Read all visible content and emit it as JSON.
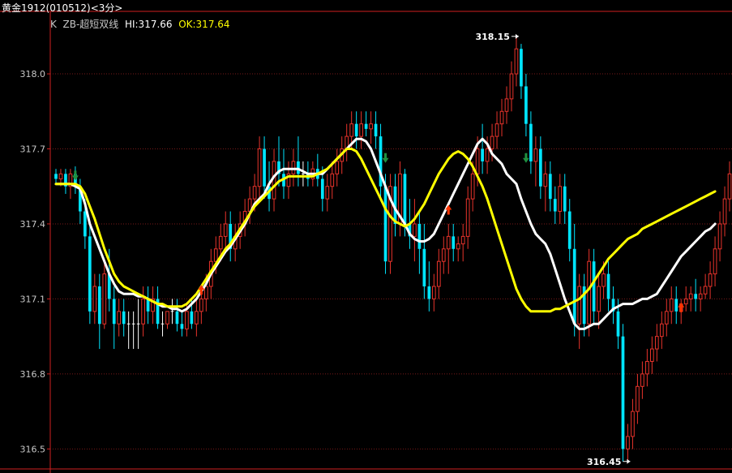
{
  "header": {
    "title": "黄金1912(010512)<3分>",
    "legend_prefix": "K",
    "indicator": "ZB-超短双线",
    "hi_label": "HI:317.66",
    "ok_label": "OK:317.64"
  },
  "colors": {
    "background": "#000000",
    "axis": "#d02020",
    "grid": "#7a1a1a",
    "up": "#e8332b",
    "down": "#00e5ff",
    "hi_line": "#ffffff",
    "ok_line": "#ffff00",
    "tick_text": "#c8c8c8",
    "marker_buy": "#ff3300",
    "marker_sell": "#1f8f3f"
  },
  "chart_data": {
    "type": "candlestick",
    "title": "",
    "xlabel": "",
    "ylabel": "",
    "ylim": [
      316.42,
      318.25
    ],
    "y_ticks": [
      "318.0",
      "317.7",
      "317.4",
      "317.1",
      "316.8",
      "316.5"
    ],
    "y_tick_values": [
      318.0,
      317.7,
      317.4,
      317.1,
      316.8,
      316.5
    ],
    "grid": "horizontal dotted",
    "annotations": {
      "high_label": "318.15",
      "high_value": 318.15,
      "high_index": 96,
      "low_label": "316.45",
      "low_value": 316.45,
      "low_index": 119
    },
    "ohlc": [
      [
        317.6,
        317.62,
        317.56,
        317.58
      ],
      [
        317.58,
        317.62,
        317.55,
        317.6
      ],
      [
        317.6,
        317.62,
        317.52,
        317.55
      ],
      [
        317.55,
        317.62,
        317.5,
        317.6
      ],
      [
        317.6,
        317.63,
        317.52,
        317.55
      ],
      [
        317.55,
        317.58,
        317.4,
        317.45
      ],
      [
        317.45,
        317.5,
        317.3,
        317.35
      ],
      [
        317.35,
        317.4,
        317.0,
        317.05
      ],
      [
        317.05,
        317.2,
        317.0,
        317.15
      ],
      [
        317.15,
        317.2,
        316.9,
        317.0
      ],
      [
        317.0,
        317.25,
        316.98,
        317.2
      ],
      [
        317.2,
        317.3,
        317.05,
        317.1
      ],
      [
        317.1,
        317.15,
        316.9,
        317.0
      ],
      [
        317.0,
        317.1,
        316.95,
        317.05
      ],
      [
        317.05,
        317.1,
        316.95,
        317.0
      ],
      [
        317.0,
        317.05,
        316.9,
        317.0
      ],
      [
        317.0,
        317.05,
        316.9,
        317.0
      ],
      [
        317.0,
        317.1,
        316.9,
        317.0
      ],
      [
        317.0,
        317.15,
        316.95,
        317.1
      ],
      [
        317.1,
        317.15,
        317.0,
        317.05
      ],
      [
        317.05,
        317.15,
        317.0,
        317.1
      ],
      [
        317.1,
        317.15,
        316.98,
        317.0
      ],
      [
        317.0,
        317.05,
        316.95,
        317.0
      ],
      [
        317.0,
        317.05,
        316.98,
        317.05
      ],
      [
        317.05,
        317.1,
        317.0,
        317.05
      ],
      [
        317.05,
        317.1,
        316.97,
        317.0
      ],
      [
        317.0,
        317.05,
        316.95,
        316.98
      ],
      [
        316.98,
        317.08,
        316.95,
        317.05
      ],
      [
        317.05,
        317.1,
        316.98,
        317.0
      ],
      [
        317.0,
        317.1,
        316.95,
        317.05
      ],
      [
        317.05,
        317.15,
        317.0,
        317.1
      ],
      [
        317.1,
        317.2,
        317.05,
        317.15
      ],
      [
        317.15,
        317.3,
        317.1,
        317.25
      ],
      [
        317.25,
        317.35,
        317.2,
        317.3
      ],
      [
        317.3,
        317.4,
        317.25,
        317.35
      ],
      [
        317.35,
        317.45,
        317.3,
        317.4
      ],
      [
        317.4,
        317.45,
        317.25,
        317.3
      ],
      [
        317.3,
        317.4,
        317.25,
        317.35
      ],
      [
        317.35,
        317.45,
        317.3,
        317.4
      ],
      [
        317.4,
        317.5,
        317.35,
        317.45
      ],
      [
        317.45,
        317.55,
        317.4,
        317.5
      ],
      [
        317.5,
        317.6,
        317.45,
        317.55
      ],
      [
        317.55,
        317.75,
        317.5,
        317.7
      ],
      [
        317.7,
        317.75,
        317.5,
        317.55
      ],
      [
        317.55,
        317.65,
        317.45,
        317.5
      ],
      [
        317.5,
        317.7,
        317.45,
        317.65
      ],
      [
        317.65,
        317.75,
        317.55,
        317.6
      ],
      [
        317.6,
        317.7,
        317.5,
        317.55
      ],
      [
        317.55,
        317.65,
        317.5,
        317.6
      ],
      [
        317.6,
        317.7,
        317.55,
        317.65
      ],
      [
        317.65,
        317.75,
        317.55,
        317.6
      ],
      [
        317.6,
        317.65,
        317.55,
        317.6
      ],
      [
        317.6,
        317.65,
        317.55,
        317.58
      ],
      [
        317.58,
        317.65,
        317.55,
        317.62
      ],
      [
        317.62,
        317.68,
        317.55,
        317.58
      ],
      [
        317.58,
        317.63,
        317.45,
        317.5
      ],
      [
        317.5,
        317.6,
        317.45,
        317.55
      ],
      [
        317.55,
        317.65,
        317.5,
        317.6
      ],
      [
        317.6,
        317.7,
        317.55,
        317.65
      ],
      [
        317.65,
        317.75,
        317.6,
        317.7
      ],
      [
        317.7,
        317.8,
        317.65,
        317.75
      ],
      [
        317.75,
        317.85,
        317.7,
        317.8
      ],
      [
        317.8,
        317.85,
        317.7,
        317.75
      ],
      [
        317.75,
        317.85,
        317.7,
        317.8
      ],
      [
        317.8,
        317.85,
        317.75,
        317.78
      ],
      [
        317.78,
        317.85,
        317.72,
        317.8
      ],
      [
        317.8,
        317.85,
        317.7,
        317.75
      ],
      [
        317.75,
        317.8,
        317.5,
        317.55
      ],
      [
        317.55,
        317.6,
        317.2,
        317.25
      ],
      [
        317.25,
        317.6,
        317.2,
        317.55
      ],
      [
        317.55,
        317.6,
        317.35,
        317.4
      ],
      [
        317.4,
        317.65,
        317.35,
        317.6
      ],
      [
        317.6,
        317.62,
        317.35,
        317.4
      ],
      [
        317.4,
        317.5,
        317.3,
        317.35
      ],
      [
        317.35,
        317.5,
        317.25,
        317.4
      ],
      [
        317.4,
        317.45,
        317.2,
        317.3
      ],
      [
        317.3,
        317.4,
        317.1,
        317.15
      ],
      [
        317.15,
        317.25,
        317.05,
        317.1
      ],
      [
        317.1,
        317.2,
        317.05,
        317.15
      ],
      [
        317.15,
        317.3,
        317.1,
        317.25
      ],
      [
        317.25,
        317.35,
        317.2,
        317.3
      ],
      [
        317.3,
        317.4,
        317.2,
        317.35
      ],
      [
        317.35,
        317.4,
        317.25,
        317.3
      ],
      [
        317.3,
        317.35,
        317.25,
        317.32
      ],
      [
        317.32,
        317.4,
        317.25,
        317.35
      ],
      [
        317.35,
        317.55,
        317.3,
        317.5
      ],
      [
        317.5,
        317.65,
        317.45,
        317.6
      ],
      [
        317.6,
        317.75,
        317.55,
        317.7
      ],
      [
        317.7,
        317.8,
        317.6,
        317.65
      ],
      [
        317.65,
        317.75,
        317.6,
        317.7
      ],
      [
        317.7,
        317.8,
        317.65,
        317.75
      ],
      [
        317.75,
        317.85,
        317.7,
        317.8
      ],
      [
        317.8,
        317.9,
        317.75,
        317.85
      ],
      [
        317.85,
        317.95,
        317.8,
        317.9
      ],
      [
        317.9,
        318.05,
        317.85,
        318.0
      ],
      [
        318.0,
        318.15,
        317.95,
        318.1
      ],
      [
        318.1,
        318.12,
        317.9,
        317.95
      ],
      [
        317.95,
        318.0,
        317.75,
        317.8
      ],
      [
        317.8,
        317.85,
        317.6,
        317.65
      ],
      [
        317.65,
        317.75,
        317.55,
        317.7
      ],
      [
        317.7,
        317.75,
        317.5,
        317.55
      ],
      [
        317.55,
        317.65,
        317.45,
        317.6
      ],
      [
        317.6,
        317.65,
        317.45,
        317.5
      ],
      [
        317.5,
        317.55,
        317.4,
        317.45
      ],
      [
        317.45,
        317.6,
        317.4,
        317.55
      ],
      [
        317.55,
        317.6,
        317.4,
        317.45
      ],
      [
        317.45,
        317.5,
        317.25,
        317.3
      ],
      [
        317.3,
        317.4,
        316.95,
        317.0
      ],
      [
        317.0,
        317.2,
        316.9,
        317.15
      ],
      [
        317.15,
        317.2,
        316.95,
        317.0
      ],
      [
        317.0,
        317.3,
        316.95,
        317.25
      ],
      [
        317.25,
        317.3,
        317.0,
        317.05
      ],
      [
        317.05,
        317.2,
        316.98,
        317.15
      ],
      [
        317.15,
        317.25,
        317.1,
        317.2
      ],
      [
        317.2,
        317.25,
        317.05,
        317.1
      ],
      [
        317.1,
        317.15,
        317.0,
        317.05
      ],
      [
        317.05,
        317.1,
        316.9,
        316.95
      ],
      [
        316.95,
        317.0,
        316.45,
        316.5
      ],
      [
        316.5,
        316.6,
        316.45,
        316.55
      ],
      [
        316.55,
        316.7,
        316.5,
        316.65
      ],
      [
        316.65,
        316.8,
        316.6,
        316.75
      ],
      [
        316.75,
        316.85,
        316.7,
        316.8
      ],
      [
        316.8,
        316.9,
        316.75,
        316.85
      ],
      [
        316.85,
        316.95,
        316.8,
        316.9
      ],
      [
        316.9,
        317.0,
        316.85,
        316.95
      ],
      [
        316.95,
        317.05,
        316.9,
        317.0
      ],
      [
        317.0,
        317.1,
        316.95,
        317.05
      ],
      [
        317.05,
        317.15,
        317.0,
        317.1
      ],
      [
        317.1,
        317.15,
        317.0,
        317.05
      ],
      [
        317.05,
        317.1,
        317.0,
        317.08
      ],
      [
        317.08,
        317.15,
        317.05,
        317.1
      ],
      [
        317.1,
        317.15,
        317.05,
        317.12
      ],
      [
        317.12,
        317.18,
        317.05,
        317.1
      ],
      [
        317.1,
        317.15,
        317.05,
        317.12
      ],
      [
        317.12,
        317.2,
        317.1,
        317.15
      ],
      [
        317.15,
        317.25,
        317.1,
        317.2
      ],
      [
        317.2,
        317.35,
        317.15,
        317.3
      ],
      [
        317.3,
        317.45,
        317.25,
        317.4
      ],
      [
        317.4,
        317.55,
        317.35,
        317.5
      ],
      [
        317.5,
        317.65,
        317.45,
        317.6
      ]
    ],
    "series": [
      {
        "name": "HI",
        "values": [
          317.56,
          317.56,
          317.56,
          317.56,
          317.55,
          317.54,
          317.48,
          317.4,
          317.35,
          317.3,
          317.25,
          317.2,
          317.16,
          317.13,
          317.12,
          317.12,
          317.12,
          317.11,
          317.11,
          317.1,
          317.09,
          317.08,
          317.07,
          317.07,
          317.06,
          317.06,
          317.05,
          317.06,
          317.08,
          317.1,
          317.13,
          317.16,
          317.2,
          317.23,
          317.26,
          317.29,
          317.31,
          317.34,
          317.37,
          317.4,
          317.44,
          317.48,
          317.5,
          317.52,
          317.56,
          317.59,
          317.61,
          317.62,
          317.62,
          317.62,
          317.62,
          317.61,
          317.6,
          317.6,
          317.6,
          317.6,
          317.62,
          317.64,
          317.66,
          317.68,
          317.7,
          317.72,
          317.74,
          317.74,
          317.73,
          317.7,
          317.65,
          317.6,
          317.55,
          317.5,
          317.46,
          317.43,
          317.4,
          317.36,
          317.34,
          317.33,
          317.33,
          317.34,
          317.36,
          317.4,
          317.44,
          317.48,
          317.52,
          317.56,
          317.6,
          317.64,
          317.68,
          317.72,
          317.74,
          317.72,
          317.68,
          317.66,
          317.64,
          317.6,
          317.58,
          317.56,
          317.5,
          317.45,
          317.4,
          317.36,
          317.34,
          317.32,
          317.28,
          317.22,
          317.16,
          317.1,
          317.05,
          317.0,
          316.98,
          316.98,
          316.99,
          317.0,
          317.0,
          317.02,
          317.04,
          317.06,
          317.07,
          317.08,
          317.08,
          317.08,
          317.09,
          317.1,
          317.1,
          317.11,
          317.12,
          317.15,
          317.18,
          317.21,
          317.24,
          317.27,
          317.29,
          317.31,
          317.33,
          317.35,
          317.37,
          317.38,
          317.4
        ]
      },
      {
        "name": "OK",
        "values": [
          317.56,
          317.56,
          317.56,
          317.56,
          317.56,
          317.55,
          317.52,
          317.47,
          317.42,
          317.36,
          317.3,
          317.25,
          317.2,
          317.17,
          317.15,
          317.14,
          317.13,
          317.12,
          317.11,
          317.1,
          317.09,
          317.08,
          317.08,
          317.07,
          317.07,
          317.07,
          317.07,
          317.08,
          317.1,
          317.12,
          317.15,
          317.18,
          317.21,
          317.24,
          317.27,
          317.3,
          317.32,
          317.35,
          317.38,
          317.41,
          317.44,
          317.47,
          317.49,
          317.51,
          317.53,
          317.55,
          317.57,
          317.58,
          317.59,
          317.59,
          317.59,
          317.59,
          317.59,
          317.59,
          317.6,
          317.61,
          317.62,
          317.64,
          317.66,
          317.68,
          317.7,
          317.7,
          317.69,
          317.66,
          317.62,
          317.58,
          317.54,
          317.5,
          317.46,
          317.43,
          317.41,
          317.4,
          317.39,
          317.4,
          317.42,
          317.45,
          317.48,
          317.52,
          317.56,
          317.6,
          317.63,
          317.66,
          317.68,
          317.69,
          317.68,
          317.66,
          317.63,
          317.59,
          317.55,
          317.5,
          317.44,
          317.38,
          317.32,
          317.26,
          317.2,
          317.14,
          317.1,
          317.07,
          317.05,
          317.05,
          317.05,
          317.05,
          317.05,
          317.06,
          317.06,
          317.07,
          317.08,
          317.09,
          317.1,
          317.12,
          317.14,
          317.17,
          317.2,
          317.23,
          317.26,
          317.28,
          317.3,
          317.32,
          317.34,
          317.35,
          317.36,
          317.38,
          317.39,
          317.4,
          317.41,
          317.42,
          317.43,
          317.44,
          317.45,
          317.46,
          317.47,
          317.48,
          317.49,
          317.5,
          317.51,
          317.52,
          317.53
        ]
      }
    ],
    "signals": [
      {
        "index": 4,
        "kind": "sell",
        "value": 317.6
      },
      {
        "index": 30,
        "kind": "buy",
        "value": 317.13
      },
      {
        "index": 68,
        "kind": "sell",
        "value": 317.67
      },
      {
        "index": 81,
        "kind": "buy",
        "value": 317.45
      },
      {
        "index": 97,
        "kind": "sell",
        "value": 317.67
      },
      {
        "index": 129,
        "kind": "buy",
        "value": 317.06
      }
    ]
  }
}
